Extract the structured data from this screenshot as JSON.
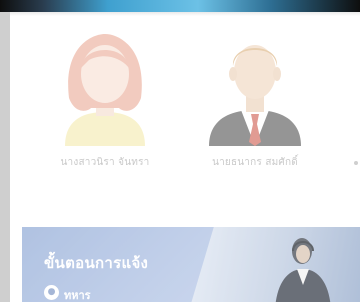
{
  "profiles": [
    {
      "name": "นางสาวนิรา จันทรา"
    },
    {
      "name": "นายธนากร สมศักดิ์"
    }
  ],
  "banner": {
    "title": "ขั้นตอนการแจ้ง",
    "logo_text": "ทหาร"
  },
  "colors": {
    "banner_blue": "#8fa9d6",
    "name_text": "#c9c9c9"
  },
  "icons": {
    "female_avatar": "female-avatar-icon",
    "male_avatar": "male-avatar-icon",
    "logo": "logo-icon"
  }
}
